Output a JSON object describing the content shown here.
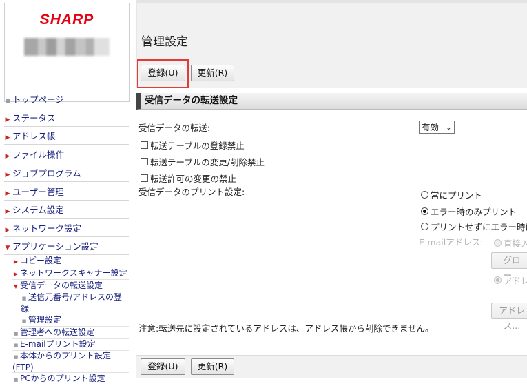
{
  "brand": {
    "logo_text": "SHARP"
  },
  "sidebar": {
    "items": [
      {
        "label": "トップページ"
      },
      {
        "label": "ステータス"
      },
      {
        "label": "アドレス帳"
      },
      {
        "label": "ファイル操作"
      },
      {
        "label": "ジョブプログラム"
      },
      {
        "label": "ユーザー管理"
      },
      {
        "label": "システム設定"
      },
      {
        "label": "ネットワーク設定"
      },
      {
        "label": "アプリケーション設定"
      }
    ],
    "sub_items": [
      {
        "label": "コピー設定"
      },
      {
        "label": "ネットワークスキャナー設定"
      },
      {
        "label": "受信データの転送設定"
      },
      {
        "label": "送信元番号/アドレスの登録"
      },
      {
        "label": "管理設定"
      },
      {
        "label": "管理者への転送設定"
      },
      {
        "label": "E-mailプリント設定"
      },
      {
        "label": "本体からのプリント設定(FTP)"
      },
      {
        "label": "PCからのプリント設定"
      }
    ]
  },
  "main": {
    "title": "管理設定",
    "buttons": {
      "register": "登録(U)",
      "update": "更新(R)"
    },
    "section_title": "受信データの転送設定",
    "forward": {
      "label": "受信データの転送:",
      "selected": "有効",
      "checkboxes": [
        {
          "label": "転送テーブルの登録禁止",
          "checked": false
        },
        {
          "label": "転送テーブルの変更/削除禁止",
          "checked": false
        },
        {
          "label": "転送許可の変更の禁止",
          "checked": false
        }
      ]
    },
    "print": {
      "label": "受信データのプリント設定:",
      "options": [
        {
          "label": "常にプリント",
          "selected": false
        },
        {
          "label": "エラー時のみプリント",
          "selected": true
        },
        {
          "label": "プリントせずにエラー時は...",
          "selected": false
        }
      ]
    },
    "email": {
      "label": "E-mailアドレス:",
      "direct_label": "直接入...",
      "global_button": "グロー...",
      "address_label": "アドレ...",
      "address_button": "アドレス..."
    },
    "note": "注意:転送先に設定されているアドレスは、アドレス帳から削除できません。"
  }
}
